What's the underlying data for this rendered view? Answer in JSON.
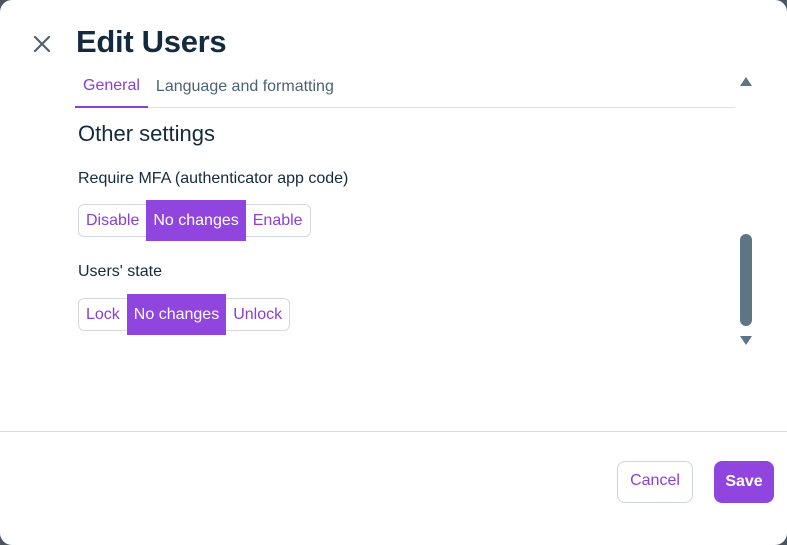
{
  "dialog": {
    "title": "Edit Users",
    "close_icon": "close-icon"
  },
  "tabs": [
    {
      "label": "General",
      "active": true
    },
    {
      "label": "Language and formatting",
      "active": false
    }
  ],
  "section": {
    "title": "Other settings"
  },
  "fields": {
    "mfa": {
      "label": "Require MFA (authenticator app code)",
      "options": [
        "Disable",
        "No changes",
        "Enable"
      ],
      "selected": "No changes"
    },
    "state": {
      "label": "Users' state",
      "options": [
        "Lock",
        "No changes",
        "Unlock"
      ],
      "selected": "No changes"
    }
  },
  "footer": {
    "cancel_label": "Cancel",
    "save_label": "Save"
  },
  "colors": {
    "accent": "#8f45de",
    "title": "#142b3f",
    "scrollbar": "#5e7585"
  }
}
